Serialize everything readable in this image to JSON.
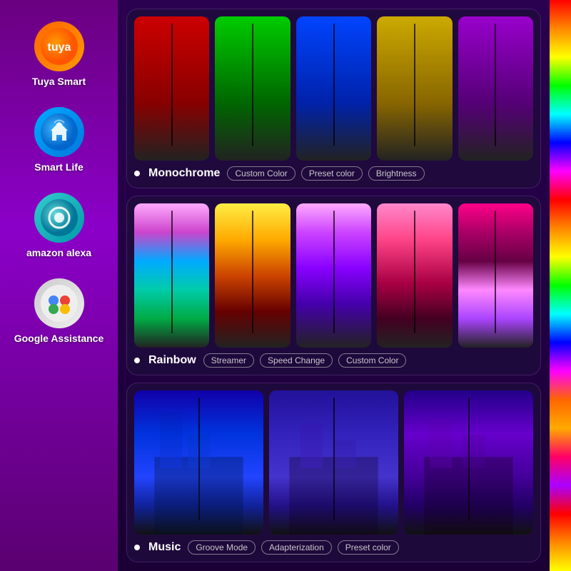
{
  "sidebar": {
    "items": [
      {
        "id": "tuya",
        "label": "Tuya Smart",
        "icon": "tuya-icon"
      },
      {
        "id": "smartlife",
        "label": "Smart Life",
        "icon": "smartlife-icon"
      },
      {
        "id": "alexa",
        "label": "amazon alexa",
        "icon": "alexa-icon"
      },
      {
        "id": "google",
        "label": "Google Assistance",
        "icon": "google-icon"
      }
    ]
  },
  "modes": [
    {
      "id": "monochrome",
      "name": "Monochrome",
      "tags": [
        "Custom Color",
        "Preset color",
        "Brightness"
      ],
      "lamps": [
        "red",
        "green",
        "blue",
        "yellow",
        "purple"
      ]
    },
    {
      "id": "rainbow",
      "name": "Rainbow",
      "tags": [
        "Streamer",
        "Speed Change",
        "Custom Color"
      ],
      "lamps": [
        "rainbow1",
        "rainbow2",
        "rainbow3",
        "rainbow4",
        "rainbow5"
      ]
    },
    {
      "id": "music",
      "name": "Music",
      "tags": [
        "Groove Mode",
        "Adapterization",
        "Preset color"
      ],
      "lamps": [
        "music1",
        "music2",
        "music3"
      ]
    }
  ],
  "colors": {
    "sidebar_bg_top": "#6a0080",
    "sidebar_bg_bottom": "#5a0070",
    "panel_bg": "rgba(30,10,60,0.85)",
    "accent": "#cc66ff"
  }
}
